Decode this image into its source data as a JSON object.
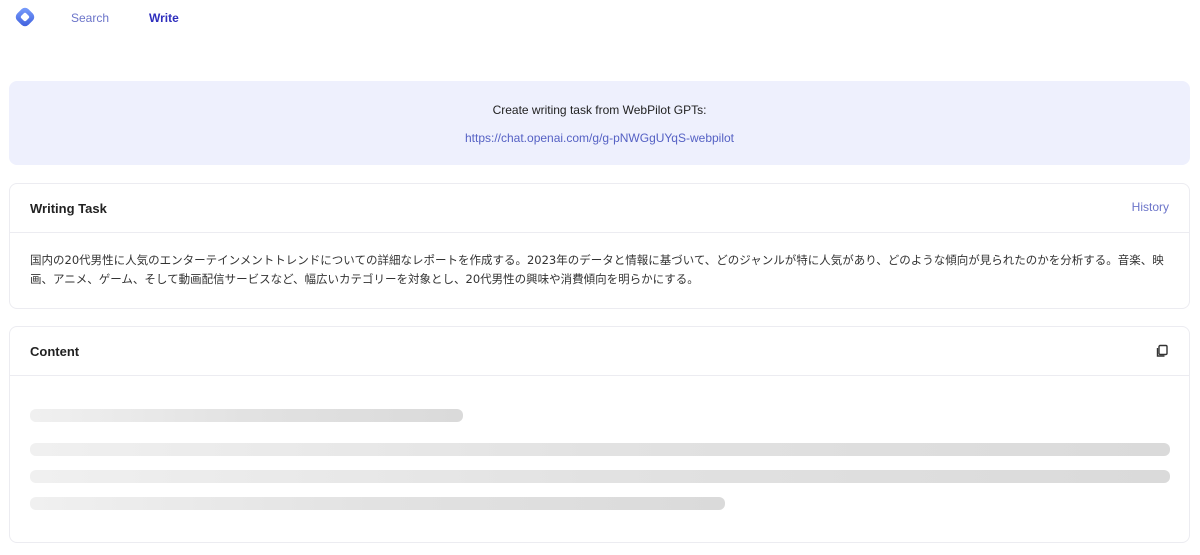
{
  "nav": {
    "logo_icon": "webpilot-logo-icon",
    "items": [
      {
        "label": "Search",
        "active": false
      },
      {
        "label": "Write",
        "active": true
      }
    ]
  },
  "banner": {
    "title": "Create writing task from WebPilot GPTs:",
    "link": "https://chat.openai.com/g/g-pNWGgUYqS-webpilot"
  },
  "writing_task": {
    "title": "Writing Task",
    "history_label": "History",
    "text": "国内の20代男性に人気のエンターテインメントトレンドについての詳細なレポートを作成する。2023年のデータと情報に基づいて、どのジャンルが特に人気があり、どのような傾向が見られたのかを分析する。音楽、映画、アニメ、ゲーム、そして動画配信サービスなど、幅広いカテゴリーを対象とし、20代男性の興味や消費傾向を明らかにする。"
  },
  "content": {
    "title": "Content",
    "copy_icon": "copy-icon",
    "loading": true
  },
  "colors": {
    "accent": "#2f2fbd",
    "link": "#5561c4",
    "banner_bg": "#eef0fd",
    "border": "#ececf1"
  }
}
